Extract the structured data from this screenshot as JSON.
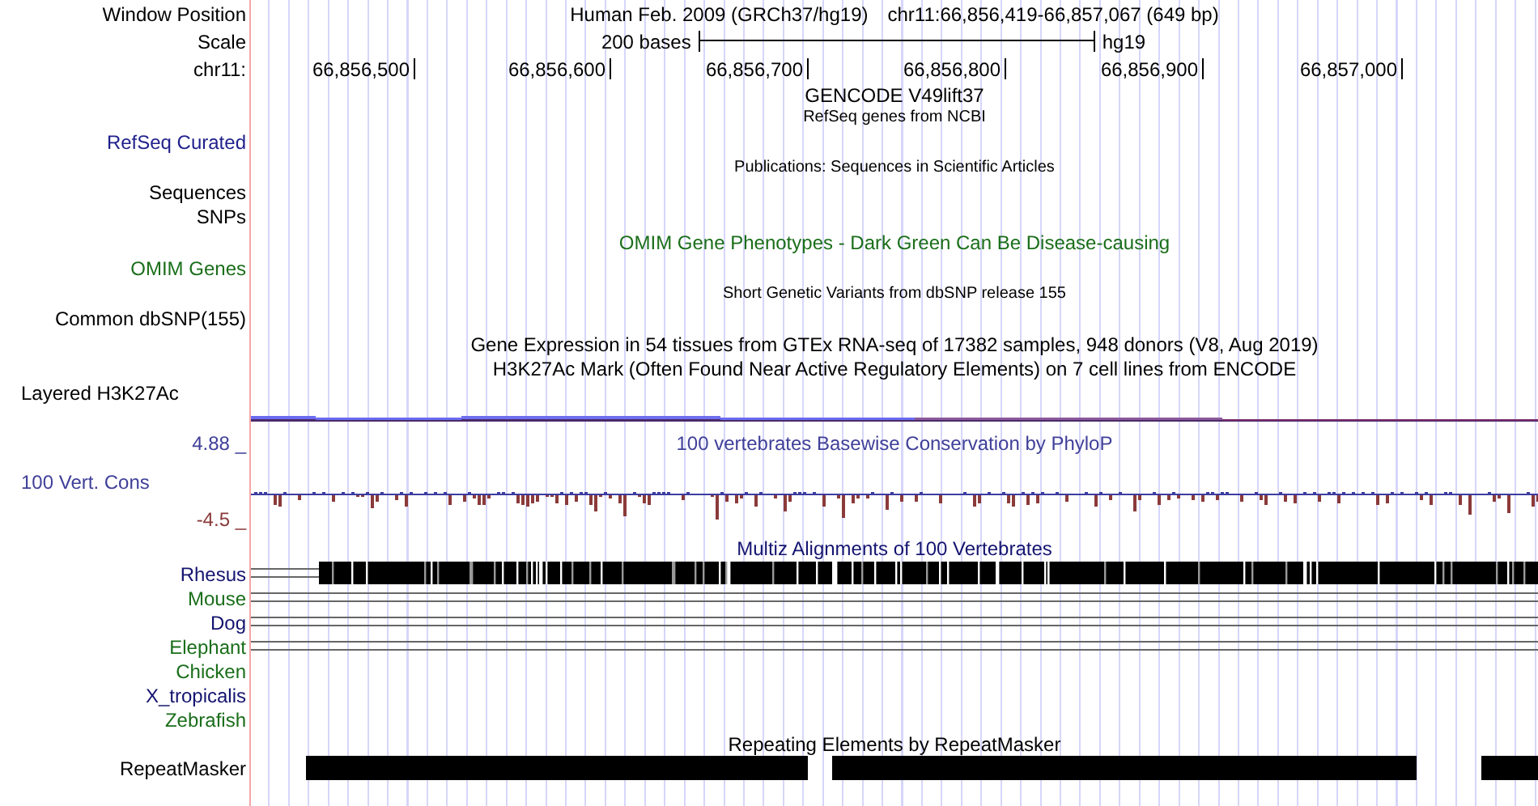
{
  "rows": [
    {
      "kind": "position",
      "label": "Window Position",
      "texts": [
        "Human Feb. 2009 (GRCh37/hg19)",
        "chr11:66,856,419-66,857,067 (649 bp)"
      ]
    },
    {
      "kind": "scale",
      "label": "Scale",
      "text": "200 bases",
      "end_text": "hg19"
    },
    {
      "kind": "ruler",
      "label": "chr11:",
      "ticks": [
        "66,856,500",
        "66,856,600",
        "66,856,700",
        "66,856,800",
        "66,856,900",
        "66,857,000"
      ]
    },
    {
      "kind": "title",
      "text": "GENCODE V49lift37"
    },
    {
      "kind": "caption",
      "text": "RefSeq genes from NCBI"
    },
    {
      "kind": "track",
      "label": "RefSeq Curated",
      "color": "#1f1f8c"
    },
    {
      "kind": "caption",
      "text": "Publications: Sequences in Scientific Articles"
    },
    {
      "kind": "track",
      "label": "Sequences",
      "color": "#000000"
    },
    {
      "kind": "track",
      "label": "SNPs",
      "color": "#000000"
    },
    {
      "kind": "title",
      "text": "OMIM Gene Phenotypes - Dark Green Can Be Disease-causing",
      "color": "#1a6e1a"
    },
    {
      "kind": "track",
      "label": "OMIM Genes",
      "color": "#1a6e1a"
    },
    {
      "kind": "caption",
      "text": "Short Genetic Variants from dbSNP release 155"
    },
    {
      "kind": "track",
      "label": "Common dbSNP(155)",
      "color": "#000000"
    },
    {
      "kind": "title",
      "text": "Gene Expression in 54 tissues from GTEx RNA-seq of 17382 samples, 948 donors (V8, Aug 2019)"
    },
    {
      "kind": "title",
      "text": "H3K27Ac Mark (Often Found Near Active Regulatory Elements) on 7 cell lines from ENCODE"
    },
    {
      "kind": "left-track",
      "label": "Layered H3K27Ac",
      "color": "#000000"
    },
    {
      "kind": "signal"
    },
    {
      "kind": "title",
      "label": "4.88 _",
      "text": "100 vertebrates Basewise Conservation by PhyloP",
      "color": "#40409a"
    },
    {
      "kind": "wiggle",
      "label": "100 Vert. Cons",
      "color": "#40409a",
      "min_label": "-4.5 _"
    },
    {
      "kind": "title",
      "text": "Multiz Alignments of 100 Vertebrates",
      "color": "#141470"
    },
    {
      "kind": "species-blocks",
      "label": "Rhesus",
      "color": "#141470"
    },
    {
      "kind": "species-lines",
      "label": "Mouse",
      "color": "#1a6e1a"
    },
    {
      "kind": "species-lines",
      "label": "Dog",
      "color": "#141470"
    },
    {
      "kind": "species-lines",
      "label": "Elephant",
      "color": "#1a6e1a"
    },
    {
      "kind": "species",
      "label": "Chicken",
      "color": "#1a6e1a"
    },
    {
      "kind": "species",
      "label": "X_tropicalis",
      "color": "#141470"
    },
    {
      "kind": "species",
      "label": "Zebrafish",
      "color": "#1a6e1a"
    },
    {
      "kind": "title",
      "text": "Repeating Elements by RepeatMasker"
    },
    {
      "kind": "repeats",
      "label": "RepeatMasker",
      "color": "#000000"
    }
  ]
}
